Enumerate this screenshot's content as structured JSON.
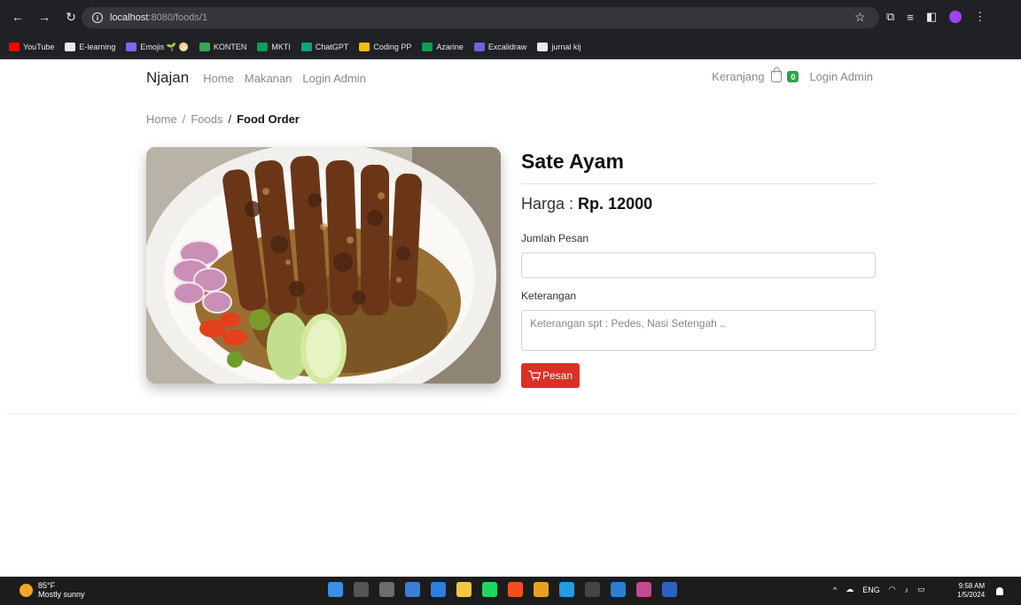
{
  "browser": {
    "url_host": "localhost",
    "url_path": ":8080/foods/1",
    "bookmarks": [
      {
        "label": "YouTube",
        "color": "#ff0000"
      },
      {
        "label": "E-learning",
        "color": "#e8eaed"
      },
      {
        "label": "Emojis 🌱 🌕",
        "color": "#7b68ee"
      },
      {
        "label": "KONTEN",
        "color": "#34a853"
      },
      {
        "label": "MKTI",
        "color": "#0f9d58"
      },
      {
        "label": "ChatGPT",
        "color": "#10a37f"
      },
      {
        "label": "Coding PP",
        "color": "#fbbc04"
      },
      {
        "label": "Azarine",
        "color": "#0f9d58"
      },
      {
        "label": "Excalidraw",
        "color": "#6965db"
      },
      {
        "label": "jurnal kij",
        "color": "#e8eaed"
      }
    ]
  },
  "navbar": {
    "brand": "Njajan",
    "links": [
      "Home",
      "Makanan",
      "Login Admin"
    ],
    "cart_label": "Keranjang",
    "cart_count": "0",
    "login_label": "Login Admin"
  },
  "breadcrumb": {
    "home": "Home",
    "foods": "Foods",
    "current": "Food Order"
  },
  "food": {
    "name": "Sate Ayam",
    "price_label": "Harga :",
    "price_value": "Rp. 12000",
    "qty_label": "Jumlah Pesan",
    "qty_value": "",
    "note_label": "Keterangan",
    "note_placeholder": "Keterangan spt : Pedes, Nasi Setengah ..",
    "order_button": "Pesan"
  },
  "taskbar": {
    "temperature": "85°F",
    "weather": "Mostly sunny",
    "lang": "ENG",
    "time": "9:58 AM",
    "date": "1/5/2024"
  },
  "colors": {
    "accent_button": "#dc3027",
    "badge": "#28a745"
  }
}
